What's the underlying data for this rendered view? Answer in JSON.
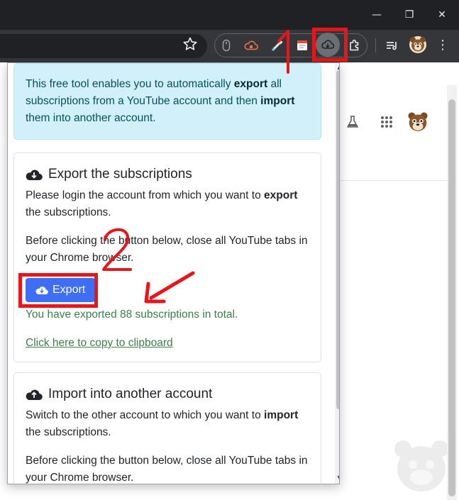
{
  "window": {
    "minimize_glyph": "—",
    "restore_glyph": "❐",
    "close_glyph": "✕"
  },
  "toolbar": {
    "menu_glyph": "⋮",
    "icons": [
      "star-icon",
      "scroll-extension-icon",
      "cloud-extension-icon",
      "eyedropper-extension-icon",
      "notes-extension-icon",
      "youtube-subscriptions-extension-icon",
      "extensions-puzzle-icon",
      "reading-list-icon",
      "profile-avatar-icon"
    ]
  },
  "annotations": {
    "step1": "1",
    "step2": "2",
    "color": "#e8161b"
  },
  "popup": {
    "intro": {
      "p1": "This free tool enables you to automatically ",
      "b1": "export",
      "p2": " all subscriptions from a YouTube account and then ",
      "b2": "import",
      "p3": " them into another account."
    },
    "export_card": {
      "title": "Export the subscriptions",
      "desc_pre": "Please login the account from which you want to ",
      "desc_bold": "export",
      "desc_post": " the subscriptions.",
      "note": "Before clicking the button below, close all YouTube tabs in your Chrome browser.",
      "button": "Export",
      "success": "You have exported 88 subscriptions in total.",
      "copy_link": "Click here to copy to clipboard"
    },
    "import_card": {
      "title": "Import into another account",
      "desc_pre": "Switch to the other account to which you want to ",
      "desc_bold": "import",
      "desc_post": " the subscriptions.",
      "note": "Before clicking the button below, close all YouTube tabs in your Chrome browser."
    }
  },
  "colors": {
    "button": "#3d6ef5",
    "success": "#3c8049",
    "alert_bg": "#d1f0fa",
    "alert_text": "#055160"
  }
}
